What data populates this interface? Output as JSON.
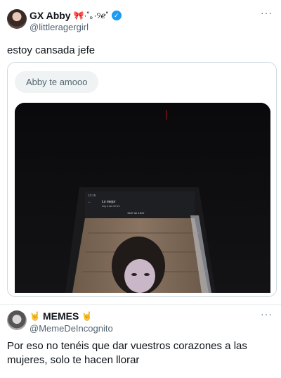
{
  "tweet": {
    "display_name": "GX Abby",
    "name_decoration": "🎀·˚｡·୨ℯ˚",
    "handle": "@littleragergirl",
    "text": "estoy cansada jefe",
    "quote": {
      "pill_text": "Abby te amooo",
      "phone_screen": {
        "time": "12:15",
        "chat_title": "Lo mejor",
        "chat_subtitle": "hoy a las 00:21",
        "chip": "1947 de 1947"
      }
    }
  },
  "reply": {
    "display_name": "MEMES",
    "handle": "@MemeDeIncognito",
    "text": "Por eso no tenéis que dar vuestros corazones a las mujeres, solo te hacen llorar",
    "emoji": "🤘"
  },
  "icons": {
    "more": "more-icon",
    "verified": "verified-badge-icon"
  },
  "colors": {
    "verified": "#1d9bf0",
    "text_primary": "#0f1419",
    "text_secondary": "#536471"
  }
}
